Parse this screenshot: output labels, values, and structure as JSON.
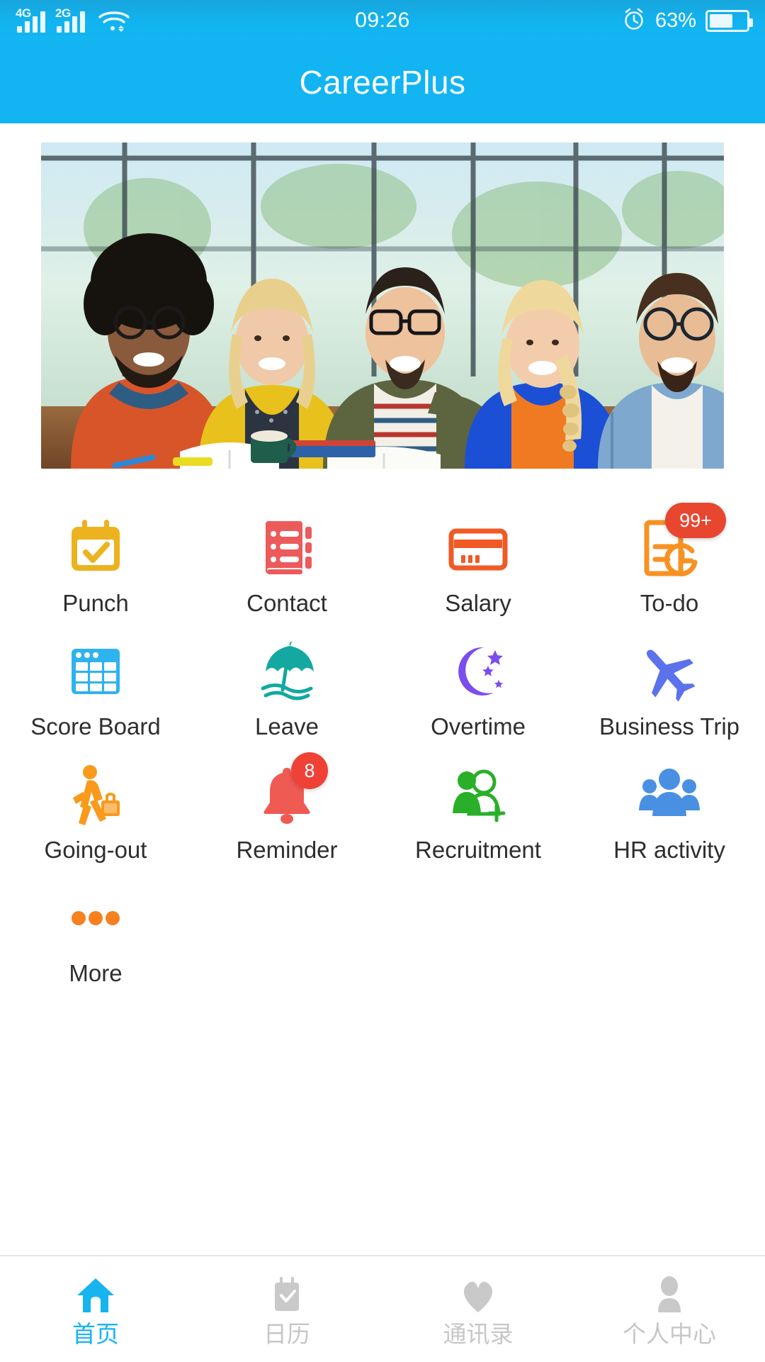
{
  "status_bar": {
    "network_1": "4G",
    "network_2": "2G",
    "wifi_icon": "wifi-icon",
    "time": "09:26",
    "alarm_icon": "alarm-clock-icon",
    "battery_percent": "63%",
    "battery_level": 63
  },
  "header": {
    "title": "CareerPlus",
    "background_color": "#12b4f2"
  },
  "banner": {
    "alt": "five smiling colleagues seated at a table with books and coffee"
  },
  "grid": {
    "items": [
      {
        "label": "Punch",
        "icon": "calendar-check-icon",
        "color": "#ecb31f",
        "badge": null
      },
      {
        "label": "Contact",
        "icon": "address-book-icon",
        "color": "#ec5a5a",
        "badge": null
      },
      {
        "label": "Salary",
        "icon": "credit-card-icon",
        "color": "#ef5a25",
        "badge": null
      },
      {
        "label": "To-do",
        "icon": "document-clock-icon",
        "color": "#f79222",
        "badge": "99+"
      },
      {
        "label": "Score Board",
        "icon": "table-grid-icon",
        "color": "#2eb3ef",
        "badge": null
      },
      {
        "label": "Leave",
        "icon": "beach-umbrella-icon",
        "color": "#13a8a0",
        "badge": null
      },
      {
        "label": "Overtime",
        "icon": "moon-stars-icon",
        "color": "#7b4ded",
        "badge": null
      },
      {
        "label": "Business Trip",
        "icon": "airplane-icon",
        "color": "#5b72ec",
        "badge": null
      },
      {
        "label": "Going-out",
        "icon": "walking-traveler-icon",
        "color": "#f99a1c",
        "badge": null
      },
      {
        "label": "Reminder",
        "icon": "bell-icon",
        "color": "#ef5a52",
        "badge": "8"
      },
      {
        "label": "Recruitment",
        "icon": "add-person-icon",
        "color": "#2aaf2a",
        "badge": null
      },
      {
        "label": "HR activity",
        "icon": "people-group-icon",
        "color": "#4a90e2",
        "badge": null
      },
      {
        "label": "More",
        "icon": "more-dots-icon",
        "color": "#f7801f",
        "badge": null
      }
    ]
  },
  "tab_bar": {
    "active_color": "#17b4f0",
    "inactive_color": "#c7c7c7",
    "tabs": [
      {
        "label": "首页",
        "icon": "home-icon",
        "active": true
      },
      {
        "label": "日历",
        "icon": "calendar-icon",
        "active": false
      },
      {
        "label": "通讯录",
        "icon": "heart-icon",
        "active": false
      },
      {
        "label": "个人中心",
        "icon": "user-profile-icon",
        "active": false
      }
    ]
  }
}
